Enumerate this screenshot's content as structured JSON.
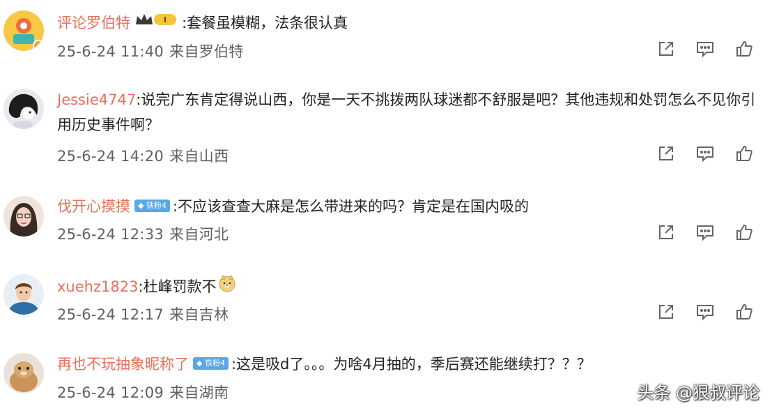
{
  "comments": [
    {
      "username": "评论罗伯特",
      "badge": "vip-crown",
      "text": ":套餐虽模糊，法条很认真",
      "time": "25-6-24 11:40",
      "source": "来自罗伯特"
    },
    {
      "username": "Jessie4747",
      "text": ":说完广东肯定得说山西，你是一天不挑拨两队球迷都不舒服是吧？其他违规和处罚怎么不见你引用历史事件啊？",
      "time": "25-6-24 14:20",
      "source": "来自山西"
    },
    {
      "username": "伐开心摸摸",
      "badge_text": "铁粉4",
      "text": ":不应该查查大麻是怎么带进来的吗？肯定是在国内吸的",
      "time": "25-6-24 12:33",
      "source": "来自河北"
    },
    {
      "username": "xuehz1823",
      "text": ":杜峰罚款不",
      "emoji": "doge-emoji",
      "time": "25-6-24 12:17",
      "source": "来自吉林"
    },
    {
      "username": "再也不玩抽象昵称了",
      "badge_text": "铁粉4",
      "text": ":这是吸d了。。。为啥4月抽的，季后赛还能继续打？？？",
      "time": "25-6-24 12:09",
      "source": "来自湖南"
    }
  ],
  "action_icons": [
    "share-icon",
    "reply-icon",
    "like-icon"
  ],
  "watermark": "头条 @狠叔评论",
  "colors": {
    "username": "#e8705a",
    "meta": "#606060",
    "fan_badge": "#5aa7e6"
  }
}
